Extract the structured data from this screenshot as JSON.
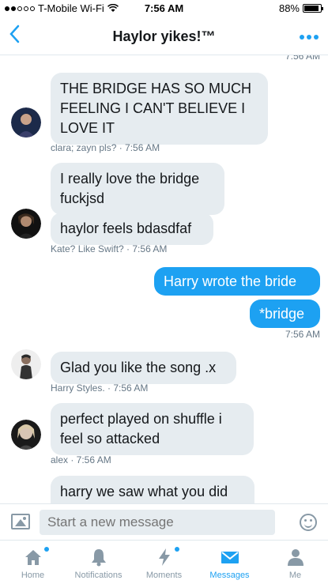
{
  "status_bar": {
    "carrier": "T-Mobile Wi-Fi",
    "time": "7:56 AM",
    "battery": "88%",
    "battery_level": 0.88
  },
  "header": {
    "title": "Haylor yikes!™"
  },
  "conversation": {
    "cut_timestamp": "7:56 AM",
    "messages": [
      {
        "text": "THE BRIDGE HAS SO MUCH FEELING I CAN'T BELIEVE I LOVE IT",
        "meta": "clara; zayn pls? · 7:56 AM"
      },
      {
        "text": "I really love the bridge fuckjsd"
      },
      {
        "text": "haylor feels bdasdfaf",
        "meta": "Kate? Like Swift? · 7:56 AM"
      },
      {
        "text": "Harry wrote the bride"
      },
      {
        "text": "*bridge",
        "meta": "7:56 AM"
      },
      {
        "text": "Glad you like the song .x",
        "meta": "Harry Styles. · 7:56 AM"
      },
      {
        "text": "perfect played on shuffle i feel so attacked",
        "meta": "alex · 7:56 AM"
      },
      {
        "text": "harry we saw what you did"
      }
    ]
  },
  "composer": {
    "placeholder": "Start a new message"
  },
  "tabs": [
    {
      "label": "Home"
    },
    {
      "label": "Notifications"
    },
    {
      "label": "Moments"
    },
    {
      "label": "Messages"
    },
    {
      "label": "Me"
    }
  ],
  "colors": {
    "accent": "#1da1f2",
    "incoming_bubble": "#e6ecf0",
    "meta_text": "#657786"
  }
}
